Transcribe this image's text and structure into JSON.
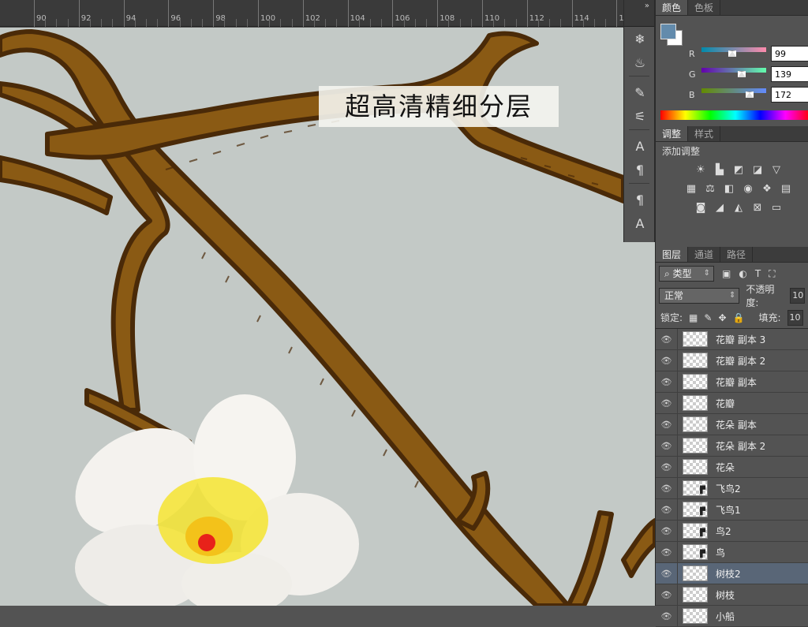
{
  "ruler": {
    "labels": [
      "90",
      "92",
      "94",
      "96",
      "98",
      "100",
      "102",
      "104",
      "106",
      "108",
      "110",
      "112",
      "114",
      "1"
    ]
  },
  "canvas": {
    "banner_text": "超高清精细分层"
  },
  "toolstrip": {
    "collapse_glyph": "»"
  },
  "color_panel": {
    "tabs": [
      "颜色",
      "色板"
    ],
    "fg_color": "#638bac",
    "channels": [
      {
        "label": "R",
        "value": "99"
      },
      {
        "label": "G",
        "value": "139"
      },
      {
        "label": "B",
        "value": "172"
      }
    ]
  },
  "adjust_panel": {
    "tabs": [
      "调整",
      "样式"
    ],
    "title": "添加调整"
  },
  "layers_panel": {
    "tabs": [
      "图层",
      "通道",
      "路径"
    ],
    "filter_kind": "类型",
    "blend_mode": "正常",
    "opacity_label": "不透明度:",
    "opacity_value": "10",
    "lock_label": "锁定:",
    "fill_label": "填充:",
    "fill_value": "10",
    "layers": [
      {
        "name": "花瓣 副本 3",
        "selected": false,
        "smart": false
      },
      {
        "name": "花瓣 副本 2",
        "selected": false,
        "smart": false
      },
      {
        "name": "花瓣 副本",
        "selected": false,
        "smart": false
      },
      {
        "name": "花瓣",
        "selected": false,
        "smart": false
      },
      {
        "name": "花朵 副本",
        "selected": false,
        "smart": false
      },
      {
        "name": "花朵 副本 2",
        "selected": false,
        "smart": false
      },
      {
        "name": "花朵",
        "selected": false,
        "smart": false
      },
      {
        "name": "飞鸟2",
        "selected": false,
        "smart": true
      },
      {
        "name": "飞鸟1",
        "selected": false,
        "smart": true
      },
      {
        "name": "鸟2",
        "selected": false,
        "smart": true
      },
      {
        "name": "鸟",
        "selected": false,
        "smart": true
      },
      {
        "name": "树枝2",
        "selected": true,
        "smart": false
      },
      {
        "name": "树枝",
        "selected": false,
        "smart": false
      },
      {
        "name": "小船",
        "selected": false,
        "smart": false
      }
    ]
  }
}
